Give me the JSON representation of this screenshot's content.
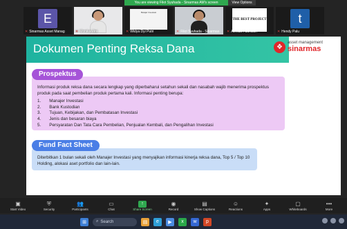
{
  "banner": {
    "message": "You are viewing Fikri Syuhada - Sinarmas AM's screen",
    "options": "View Options"
  },
  "participants": [
    {
      "name": "Sinarmas Asset Manag",
      "letter": "E",
      "color": "#5b55a8"
    },
    {
      "name": "Monika Vini"
    },
    {
      "name": "Widya Dyi Putri",
      "slide": "Belajar Investasi"
    },
    {
      "name": "Fikri Syuhada - Sinarmas"
    },
    {
      "name": "Ahmad Fadhillah",
      "logo": "THE BEST PROJECT"
    },
    {
      "name": "Hendy Palu",
      "letter": "t",
      "color": "#1f5fa8"
    }
  ],
  "slide": {
    "title": "Dokumen Penting Reksa Dana",
    "brand_line1": "asset management",
    "brand_line2": "sinarmas",
    "prospektus": {
      "label": "Prospektus",
      "text": "Informasi produk reksa dana secara lengkap yang diperbaharui setahun sekali dan nasabah wajib menerima prospektus produk pada saat pembelian produk pertama kali. Informasi penting berupa:",
      "items": [
        {
          "num": "1.",
          "text": "Manajer Investasi"
        },
        {
          "num": "2.",
          "text": "Bank Kustodian"
        },
        {
          "num": "3.",
          "text": "Tujuan, Kebijakan, dan Pembatasan Investasi"
        },
        {
          "num": "4.",
          "text": "Jenis dan besaran biaya"
        },
        {
          "num": "5.",
          "text": "Persyaratan Dan Tata Cara Pembelian, Penjualan Kembali, dan Pengalihan Investasi"
        }
      ]
    },
    "ffs": {
      "label": "Fund Fact Sheet",
      "text": "Diterbitkan 1 bulan sekali oleh Manajer Investasi yang menyajikan informasi kinerja reksa dana, Top 5 / Top 10 Holding, alokasi aset portfolio dan lain-lain."
    }
  },
  "toolbar": [
    {
      "label": "Start Video",
      "icon": "video-off-icon",
      "glyph": "▣"
    },
    {
      "label": "Security",
      "icon": "shield-icon",
      "glyph": "⛨"
    },
    {
      "label": "Participants",
      "icon": "participants-icon",
      "glyph": "👥"
    },
    {
      "label": "Chat",
      "icon": "chat-icon",
      "glyph": "▭"
    },
    {
      "label": "Share Screen",
      "icon": "share-screen-icon",
      "glyph": "↑"
    },
    {
      "label": "Record",
      "icon": "record-icon",
      "glyph": "◉"
    },
    {
      "label": "Show Captions",
      "icon": "captions-icon",
      "glyph": "▤"
    },
    {
      "label": "Reactions",
      "icon": "reactions-icon",
      "glyph": "☺"
    },
    {
      "label": "Apps",
      "icon": "apps-icon",
      "glyph": "✦"
    },
    {
      "label": "Whiteboards",
      "icon": "whiteboard-icon",
      "glyph": "▢"
    },
    {
      "label": "More",
      "icon": "more-icon",
      "glyph": "•••"
    }
  ],
  "taskbar": {
    "search_label": "Search"
  }
}
